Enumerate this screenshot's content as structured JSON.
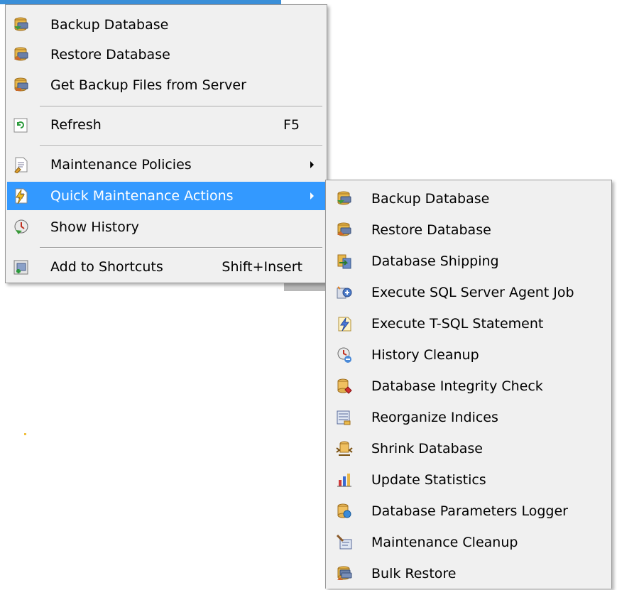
{
  "main_menu": {
    "items": [
      {
        "label": "Backup Database",
        "icon": "backup-database-icon"
      },
      {
        "label": "Restore Database",
        "icon": "restore-database-icon"
      },
      {
        "label": "Get Backup Files from Server",
        "icon": "get-backup-files-icon"
      },
      {
        "label": "Refresh",
        "shortcut": "F5",
        "icon": "refresh-icon"
      },
      {
        "label": "Maintenance Policies",
        "icon": "maintenance-policies-icon",
        "has_submenu": true
      },
      {
        "label": "Quick Maintenance Actions",
        "icon": "quick-maintenance-icon",
        "has_submenu": true,
        "highlighted": true
      },
      {
        "label": "Show History",
        "icon": "show-history-icon"
      },
      {
        "label": "Add to Shortcuts",
        "shortcut": "Shift+Insert",
        "icon": "add-to-shortcuts-icon"
      }
    ]
  },
  "sub_menu": {
    "items": [
      {
        "label": "Backup Database",
        "icon": "backup-database-icon"
      },
      {
        "label": "Restore Database",
        "icon": "restore-database-icon"
      },
      {
        "label": "Database Shipping",
        "icon": "database-shipping-icon"
      },
      {
        "label": "Execute SQL Server Agent Job",
        "icon": "agent-job-icon"
      },
      {
        "label": "Execute T-SQL Statement",
        "icon": "tsql-statement-icon"
      },
      {
        "label": "History Cleanup",
        "icon": "history-cleanup-icon"
      },
      {
        "label": "Database Integrity Check",
        "icon": "integrity-check-icon"
      },
      {
        "label": "Reorganize Indices",
        "icon": "reorganize-indices-icon"
      },
      {
        "label": "Shrink Database",
        "icon": "shrink-database-icon"
      },
      {
        "label": "Update Statistics",
        "icon": "update-statistics-icon"
      },
      {
        "label": "Database Parameters Logger",
        "icon": "parameters-logger-icon"
      },
      {
        "label": "Maintenance Cleanup",
        "icon": "maintenance-cleanup-icon"
      },
      {
        "label": "Bulk Restore",
        "icon": "bulk-restore-icon"
      }
    ]
  },
  "colors": {
    "highlight": "#3399ff",
    "menu_background": "#f0f0f0",
    "border": "#979797"
  }
}
